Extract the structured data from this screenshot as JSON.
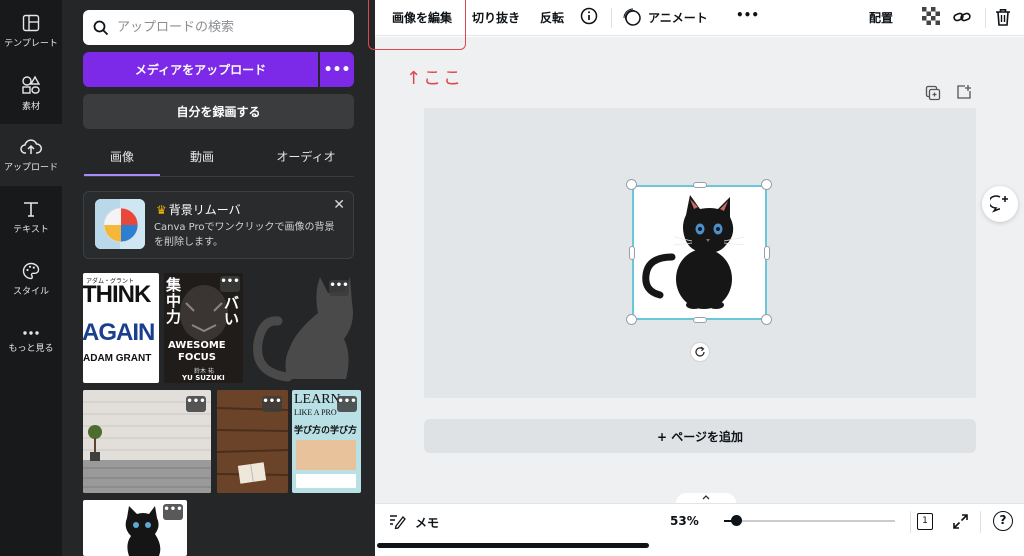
{
  "rail": {
    "items": [
      {
        "label": "テンプレート",
        "icon": "template-icon"
      },
      {
        "label": "素材",
        "icon": "elements-icon"
      },
      {
        "label": "アップロード",
        "icon": "upload-cloud-icon",
        "active": true
      },
      {
        "label": "テキスト",
        "icon": "text-icon"
      },
      {
        "label": "スタイル",
        "icon": "palette-icon"
      },
      {
        "label": "もっと見る",
        "icon": "more-dots-icon"
      }
    ]
  },
  "panel": {
    "search_placeholder": "アップロードの検索",
    "upload_button": "メディアをアップロード",
    "upload_more": "•••",
    "record_button": "自分を録画する",
    "tabs": [
      "画像",
      "動画",
      "オーディオ"
    ],
    "promo": {
      "title": "背景リムーバ",
      "description": "Canva Proでワンクリックで画像の背景を削除します。",
      "close": "✕"
    },
    "thumbnails": [
      {
        "name": "think-again-book-cover",
        "text_lines": [
          "アダム・グラント",
          "THINK",
          "AGAIN",
          "ADAM GRANT"
        ]
      },
      {
        "name": "awesome-focus-book-cover",
        "text_lines": [
          "集中力",
          "バい",
          "AWESOME",
          "FOCUS",
          "鈴木 祐",
          "YU SUZUKI"
        ]
      },
      {
        "name": "black-cat-silhouette"
      },
      {
        "name": "brick-wall-room-photo"
      },
      {
        "name": "wood-desk-reading-photo"
      },
      {
        "name": "learn-like-a-pro-book-cover",
        "text_lines": [
          "LEARN",
          "LIKE A PRO",
          "学び方の学び方"
        ]
      },
      {
        "name": "black-cat-image"
      }
    ]
  },
  "toolbar": {
    "edit_image": "画像を編集",
    "crop": "切り抜き",
    "flip": "反転",
    "animate": "アニメート",
    "more": "•••",
    "position": "配置"
  },
  "annotation": {
    "text": "↑ここ",
    "color": "#e0474c"
  },
  "canvas": {
    "add_page": "+ ページを追加"
  },
  "bottombar": {
    "memo": "メモ",
    "zoom": "53%",
    "zoom_fraction": 0.07,
    "page_count": "1",
    "help": "?"
  },
  "colors": {
    "accent": "#7d2ae8",
    "rail_bg": "#18191b",
    "panel_bg": "#252627",
    "selection": "#6ac6d8"
  }
}
